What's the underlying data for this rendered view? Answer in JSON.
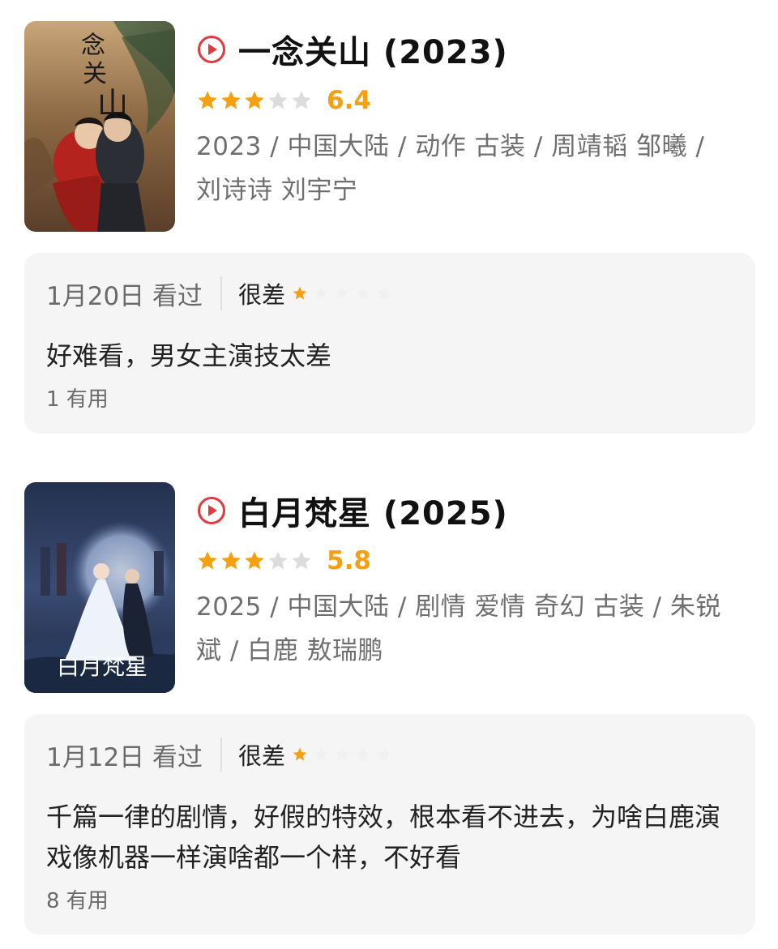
{
  "colors": {
    "accent_red": "#e4393c",
    "star_gold": "#f4a012",
    "star_empty": "#dcdcdc",
    "card_bg": "#f5f5f5"
  },
  "movies": [
    {
      "title": "一念关山 (2023)",
      "rating_stars": 3,
      "rating_max": 5,
      "score": "6.4",
      "meta": "2023 / 中国大陆 / 动作 古装 / 周靖韬 邹曦 / 刘诗诗 刘宇宁",
      "play_icon": "play-circle-icon",
      "review": {
        "date": "1月20日 看过",
        "label": "很差",
        "user_stars": 1,
        "text": "好难看，男女主演技太差",
        "useful": "1 有用"
      }
    },
    {
      "title": "白月梵星 (2025)",
      "rating_stars": 3,
      "rating_max": 5,
      "score": "5.8",
      "meta": "2025 / 中国大陆 / 剧情 爱情 奇幻 古装 / 朱锐斌 / 白鹿 敖瑞鹏",
      "play_icon": "play-circle-icon",
      "review": {
        "date": "1月12日 看过",
        "label": "很差",
        "user_stars": 1,
        "text": "千篇一律的剧情，好假的特效，根本看不进去，为啥白鹿演戏像机器一样演啥都一个样，不好看",
        "useful": "8 有用"
      }
    }
  ]
}
